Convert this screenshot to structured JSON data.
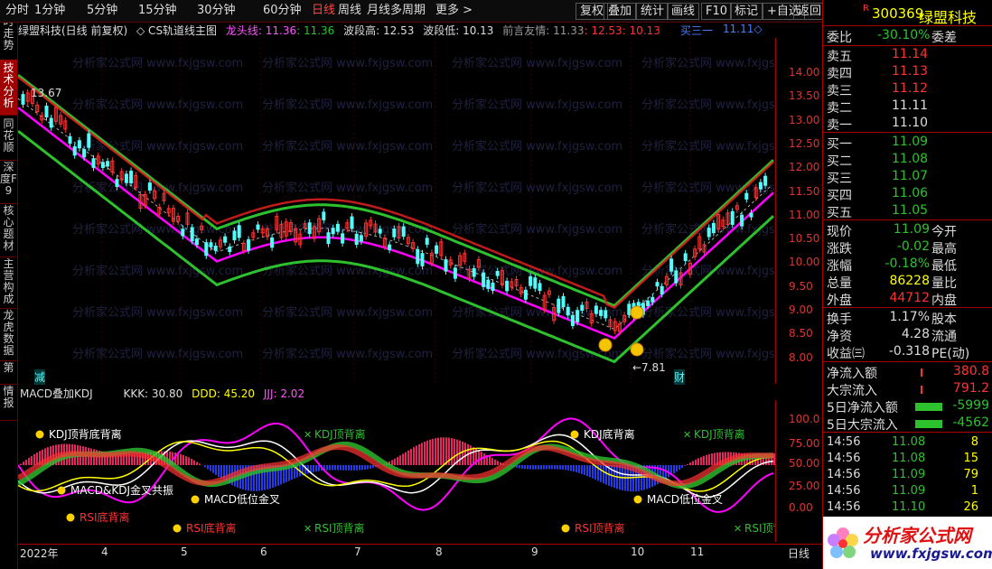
{
  "colors": {
    "up": "#ff3232",
    "down": "#54fcfc",
    "bg": "#000000",
    "accent": "#ff0000",
    "yellow": "#ffff00",
    "green": "#2ec12e",
    "magenta": "#ff00ff"
  },
  "toolbar": {
    "periods": [
      "分时",
      "1分钟",
      "5分钟",
      "15分钟",
      "30分钟",
      "60分钟",
      "日线",
      "周线",
      "月线",
      "多周期",
      "更多 >"
    ],
    "active_period": "日线",
    "buttons": [
      "复权",
      "叠加",
      "统计",
      "画线",
      "F10",
      "标记",
      "+自选",
      "返回"
    ]
  },
  "side_tabs": [
    "分时走势",
    "技术分析",
    "同花顺",
    "深度F9",
    "核心题材",
    "主营构成",
    "龙虎数据",
    "第",
    "情报"
  ],
  "active_side_tab": "技术分析",
  "chart_header": {
    "stock": "绿盟科技(日线 前复权)",
    "indicator": "◇ CS轨道线主图",
    "items": [
      {
        "label": "龙头线: ",
        "value": "11.36",
        "extra": ": 11.36"
      },
      {
        "label": "波段高: ",
        "value": "12.53"
      },
      {
        "label": "波段低: ",
        "value": "10.13"
      },
      {
        "label": "前言友情: ",
        "value": "11.33",
        "v2": ": 12.53",
        "v3": ": 10.13"
      }
    ],
    "right_label": "买三一",
    "right_value": "11.11◇"
  },
  "main_chart": {
    "high_label": "13.67",
    "low_label": "←7.81",
    "marker_left": "减",
    "marker_right": "财",
    "price_ticks": [
      "14.00",
      "13.50",
      "13.00",
      "12.50",
      "12.00",
      "11.50",
      "11.00",
      "10.50",
      "10.00",
      "9.50",
      "9.00",
      "8.50",
      "8.00"
    ]
  },
  "sub_chart": {
    "header": {
      "name": "MACD叠加KDJ",
      "kkk_label": "KKK: ",
      "kkk": "30.80",
      "ddd_label": "DDD: ",
      "ddd": "45.20",
      "jjj_label": "JJJ: ",
      "jjj": "2.02"
    },
    "ticks": [
      "100.0",
      "75.00",
      "50.00",
      "25.00",
      "0.00"
    ],
    "annotations": [
      {
        "text": "KDJ顶背底背离",
        "color": "#ffffff"
      },
      {
        "text": "KDJ顶背离",
        "color": "#2ec12e"
      },
      {
        "text": "KDJ底背离",
        "color": "#ffffff"
      },
      {
        "text": "KDJ顶背离",
        "color": "#2ec12e"
      },
      {
        "text": "MACD&KDJ金叉共振",
        "color": "#ffffff"
      },
      {
        "text": "MACD低位金叉",
        "color": "#ffffff"
      },
      {
        "text": "MACD低位金叉",
        "color": "#ffffff"
      },
      {
        "text": "RSI底背离",
        "color": "#ff3232"
      },
      {
        "text": "RSI底背离",
        "color": "#ff3232"
      },
      {
        "text": "RSI顶背离",
        "color": "#2ec12e"
      },
      {
        "text": "RSI顶背离",
        "color": "#ff3232"
      },
      {
        "text": "RSI顶背离",
        "color": "#2ec12e"
      }
    ]
  },
  "date_axis": [
    "2022年",
    "4",
    "5",
    "6",
    "7",
    "8",
    "9",
    "10",
    "11"
  ],
  "date_axis_right": "日线",
  "quote": {
    "code": "300369",
    "name": "绿盟科技",
    "wei_bi_label": "委比",
    "wei_bi": "-30.10%",
    "wei_cha_label": "委差",
    "asks": [
      {
        "label": "卖五",
        "price": "11.14"
      },
      {
        "label": "卖四",
        "price": "11.13"
      },
      {
        "label": "卖三",
        "price": "11.12"
      },
      {
        "label": "卖二",
        "price": "11.11"
      },
      {
        "label": "卖一",
        "price": "11.10"
      }
    ],
    "bids": [
      {
        "label": "买一",
        "price": "11.09"
      },
      {
        "label": "买二",
        "price": "11.08"
      },
      {
        "label": "买三",
        "price": "11.07"
      },
      {
        "label": "买四",
        "price": "11.06"
      },
      {
        "label": "买五",
        "price": "11.05"
      }
    ],
    "stats": [
      {
        "l1": "现价",
        "v1": "11.09",
        "l2": "今开"
      },
      {
        "l1": "涨跌",
        "v1": "-0.02",
        "l2": "最高"
      },
      {
        "l1": "涨幅",
        "v1": "-0.18%",
        "l2": "最低"
      },
      {
        "l1": "总量",
        "v1": "86228",
        "l2": "量比"
      },
      {
        "l1": "外盘",
        "v1": "44712",
        "l2": "内盘"
      }
    ],
    "stats2": [
      {
        "l1": "换手",
        "v1": "1.17%",
        "l2": "股本"
      },
      {
        "l1": "净资",
        "v1": "4.28",
        "l2": "流通"
      },
      {
        "l1": "收益㈢",
        "v1": "-0.318",
        "l2": "PE(动)"
      }
    ],
    "flows": [
      {
        "label": "净流入额",
        "value": "380.8"
      },
      {
        "label": "大宗流入",
        "value": "791.2"
      },
      {
        "label": "5日净流入额",
        "value": "-5999"
      },
      {
        "label": "5日大宗流入",
        "value": "-4562"
      }
    ],
    "ticks": [
      {
        "time": "14:56",
        "price": "11.08",
        "vol": "8"
      },
      {
        "time": "14:56",
        "price": "11.08",
        "vol": "15"
      },
      {
        "time": "14:56",
        "price": "11.09",
        "vol": "79"
      },
      {
        "time": "14:56",
        "price": "11.09",
        "vol": "1"
      },
      {
        "time": "14:56",
        "price": "11.10",
        "vol": "26"
      }
    ]
  },
  "logo": {
    "title": "分析家公式网",
    "url": "www.fxjgsw.com"
  },
  "watermark": "分析家公式网 www.fxjgsw.com"
}
